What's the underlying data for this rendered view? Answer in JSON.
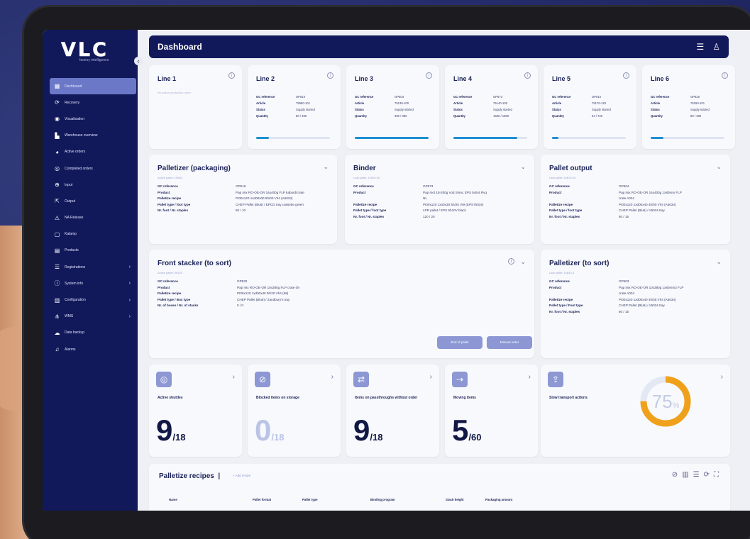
{
  "app": {
    "logo": "VLC",
    "logo_sub": "factory intelligence"
  },
  "sidebar": {
    "items": [
      {
        "label": "Dashboard",
        "icon": "grid-icon",
        "glyph": "▦",
        "active": true,
        "chevron": ""
      },
      {
        "label": "Recovery",
        "icon": "refresh-icon",
        "glyph": "⟳",
        "active": false,
        "chevron": ""
      },
      {
        "label": "Visualisation",
        "icon": "eye-icon",
        "glyph": "◉",
        "active": false,
        "chevron": ""
      },
      {
        "label": "Warehouse overview",
        "icon": "warehouse-icon",
        "glyph": "▙",
        "active": false,
        "chevron": ""
      },
      {
        "label": "Active orders",
        "icon": "pie-icon",
        "glyph": "◕",
        "active": false,
        "chevron": ""
      },
      {
        "label": "Completed orders",
        "icon": "check-circle-icon",
        "glyph": "◎",
        "active": false,
        "chevron": ""
      },
      {
        "label": "Input",
        "icon": "input-icon",
        "glyph": "⊕",
        "active": false,
        "chevron": ""
      },
      {
        "label": "Output",
        "icon": "output-icon",
        "glyph": "⇱",
        "active": false,
        "chevron": ""
      },
      {
        "label": "NA Release",
        "icon": "warning-icon",
        "glyph": "⚠",
        "active": false,
        "chevron": ""
      },
      {
        "label": "Kalamp",
        "icon": "box-icon",
        "glyph": "▢",
        "active": false,
        "chevron": ""
      },
      {
        "label": "Products",
        "icon": "document-icon",
        "glyph": "▤",
        "active": false,
        "chevron": ""
      },
      {
        "label": "Registrations",
        "icon": "list-icon",
        "glyph": "☰",
        "active": false,
        "chevron": "›"
      },
      {
        "label": "System info",
        "icon": "info-icon",
        "glyph": "ⓘ",
        "active": false,
        "chevron": "›"
      },
      {
        "label": "Configuration",
        "icon": "settings-icon",
        "glyph": "▥",
        "active": false,
        "chevron": "›"
      },
      {
        "label": "WMS",
        "icon": "network-icon",
        "glyph": "⋔",
        "active": false,
        "chevron": "›"
      },
      {
        "label": "Data backup",
        "icon": "cloud-icon",
        "glyph": "☁",
        "active": false,
        "chevron": ""
      },
      {
        "label": "Alarms",
        "icon": "bell-icon",
        "glyph": "♫",
        "active": false,
        "chevron": ""
      }
    ]
  },
  "header": {
    "title": "Dashboard"
  },
  "lines": [
    {
      "title": "Line 1",
      "empty_text": "No active production order",
      "rows": [],
      "progress": 0
    },
    {
      "title": "Line 2",
      "rows": [
        [
          "GC reference",
          "OP510"
        ],
        [
          "Article",
          "75950-101"
        ],
        [
          "Status",
          "Supply started"
        ],
        [
          "Quantity",
          "80 / 480"
        ]
      ],
      "progress": 0.17
    },
    {
      "title": "Line 3",
      "rows": [
        [
          "GC reference",
          "OP503"
        ],
        [
          "Article",
          "75130-100"
        ],
        [
          "Status",
          "Supply started"
        ],
        [
          "Quantity",
          "390 / 360"
        ]
      ],
      "progress": 1.0
    },
    {
      "title": "Line 4",
      "rows": [
        [
          "GC reference",
          "OP573"
        ],
        [
          "Article",
          "75140-100"
        ],
        [
          "Status",
          "Supply started"
        ],
        [
          "Quantity",
          "1560 / 1800"
        ]
      ],
      "progress": 0.87
    },
    {
      "title": "Line 5",
      "rows": [
        [
          "GC reference",
          "OP510"
        ],
        [
          "Article",
          "75170-120"
        ],
        [
          "Status",
          "Supply started"
        ],
        [
          "Quantity",
          "64 / 720"
        ]
      ],
      "progress": 0.09
    },
    {
      "title": "Line 6",
      "rows": [
        [
          "GC reference",
          "OP520"
        ],
        [
          "Article",
          "75150-101"
        ],
        [
          "Status",
          "Supply started"
        ],
        [
          "Quantity",
          "80 / 480"
        ]
      ],
      "progress": 0.17
    }
  ],
  "machines": [
    {
      "title": "Palletizer (packaging)",
      "sub": "Active pallet: 10850",
      "rows": [
        [
          "GC reference",
          "OP516"
        ],
        [
          "Product",
          "Pap mix RO-OE-OR 16x400g FLP kabord/crate"
        ],
        [
          "Palletize recipe",
          "PI00x120 1xd00x00 9h/00 Vh4 (A5034)"
        ],
        [
          "Pallet type / foot type",
          "CHEP Pallet (Blu6) / EPCD tray cassette green"
        ],
        [
          "Nr. foot / Nr. staples",
          "60 / 10"
        ]
      ]
    },
    {
      "title": "Binder",
      "sub": "Last pallet: 10810-05",
      "rows": [
        [
          "GC reference",
          "OP573"
        ],
        [
          "Product",
          "Pap rect 18-200g Vod SNAL EPS 5x5/4 Rvq"
        ],
        [
          "",
          "NL"
        ],
        [
          "Palletize recipe",
          "PI00x120 1x40x30 5h/20 Vr9 (EPS75034)"
        ],
        [
          "Pallet type / foot type",
          "LPR pallet / EPS 5h10V black"
        ],
        [
          "Nr. foot / Nr. staples",
          "120 / 20"
        ]
      ]
    },
    {
      "title": "Pallet output",
      "sub": "Last pallet: 10810-05",
      "rows": [
        [
          "GC reference",
          "OP504"
        ],
        [
          "Product",
          "Pap mix RO-OE-OR 16x400g 1x80mm FLP"
        ],
        [
          "",
          "crate A034"
        ],
        [
          "Palletize recipe",
          "PI00x120 1xd00x40 4h/00 Vh4 (A5034)"
        ],
        [
          "Pallet type / foot type",
          "CHEP Pallet (Blu6) / A5034 tray"
        ],
        [
          "Nr. foot / Nr. staples",
          "60 / 15"
        ]
      ]
    }
  ],
  "front_stacker": {
    "title": "Front stacker (to sort)",
    "sub": "Active pallet: 36320",
    "rows": [
      [
        "GC reference",
        "OP532"
      ],
      [
        "Product",
        "Pap mix RO-OE-OR 10x380g FLP crate 09"
      ],
      [
        "Palletize recipe",
        "PI00x120 1xd00x40 9h/20 Vh4 (58)"
      ],
      [
        "Pallet type / Box type",
        "CHEP Pallet (Blu6) / Zandbury's tray"
      ],
      [
        "Nr. of boxes / Nr. of stacks",
        "0 / 0"
      ]
    ],
    "buttons": [
      "End of pallet",
      "Manual order"
    ]
  },
  "palletizer_sort": {
    "title": "Palletizer (to sort)",
    "sub": "Last pallet: 10840-5",
    "rows": [
      [
        "GC reference",
        "OP503"
      ],
      [
        "Product",
        "Pap mix RO-OE-OR 10x380g 1x80mm3 FLP"
      ],
      [
        "",
        "crate A034"
      ],
      [
        "Palletize recipe",
        "PI00x120 1xd00x40 4h/35 Vh4 (A5034)"
      ],
      [
        "Pallet type / Foot type",
        "CHEP Pallet (Blu6) / A5034 tray"
      ],
      [
        "Nr. foot / Nr. staples",
        "60 / 15"
      ]
    ]
  },
  "stats": [
    {
      "label": "Active shuttles",
      "value": "9",
      "denominator": "/18",
      "icon": "shuttle-icon",
      "glyph": "◎",
      "dim": false
    },
    {
      "label": "Blocked items on storage",
      "value": "0",
      "denominator": "/18",
      "icon": "blocked-icon",
      "glyph": "⊘",
      "dim": true
    },
    {
      "label": "Items on passthroughs without order",
      "value": "9",
      "denominator": "/18",
      "icon": "passthrough-icon",
      "glyph": "⇄",
      "dim": false
    },
    {
      "label": "Moving items",
      "value": "5",
      "denominator": "/60",
      "icon": "moving-icon",
      "glyph": "⇢",
      "dim": false
    }
  ],
  "slow_transport": {
    "label": "Slow transport actions",
    "percent": 75,
    "percent_text": "75",
    "unit": "%",
    "icon": "upload-icon",
    "glyph": "⇪",
    "color": "#f0a11b"
  },
  "recipes": {
    "title": "Palletize recipes",
    "add_label": "+ Add recipe",
    "columns": [
      "Name",
      "Pallet format",
      "Pallet type",
      "Binding program",
      "Stack height",
      "Packaging amount"
    ]
  }
}
